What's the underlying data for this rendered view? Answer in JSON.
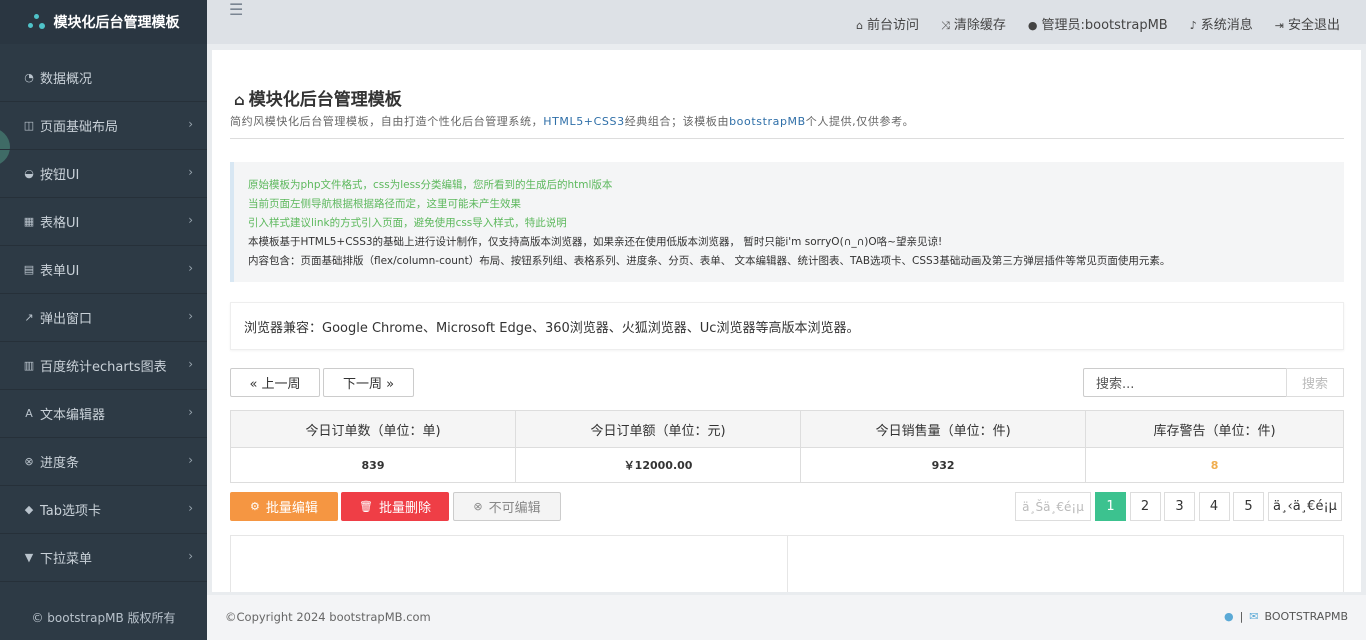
{
  "brand": {
    "title": "模块化后台管理模板"
  },
  "sidebar": {
    "items": [
      {
        "icon": "dashboard-icon",
        "glyph": "◔",
        "label": "数据概况",
        "chevron": false
      },
      {
        "icon": "columns-icon",
        "glyph": "◫",
        "label": "页面基础布局",
        "chevron": true
      },
      {
        "icon": "inbox-icon",
        "glyph": "◒",
        "label": "按钮UI",
        "chevron": true
      },
      {
        "icon": "table-icon",
        "glyph": "▦",
        "label": "表格UI",
        "chevron": true
      },
      {
        "icon": "list-alt-icon",
        "glyph": "▤",
        "label": "表单UI",
        "chevron": true
      },
      {
        "icon": "external-link-icon",
        "glyph": "↗",
        "label": "弹出窗口",
        "chevron": true
      },
      {
        "icon": "bar-chart-icon",
        "glyph": "▥",
        "label": "百度统计echarts图表",
        "chevron": true
      },
      {
        "icon": "font-icon",
        "glyph": "A",
        "label": "文本编辑器",
        "chevron": true
      },
      {
        "icon": "binoculars-icon",
        "glyph": "⊗",
        "label": "进度条",
        "chevron": true
      },
      {
        "icon": "tags-icon",
        "glyph": "◆",
        "label": "Tab选项卡",
        "chevron": true
      },
      {
        "icon": "filter-icon",
        "glyph": "▼",
        "label": "下拉菜单",
        "chevron": true
      }
    ],
    "footer": "© bootstrapMB 版权所有"
  },
  "topbar": {
    "menu_icon": "bars-icon",
    "links": [
      {
        "icon": "home-icon",
        "glyph": "⌂",
        "label": "前台访问"
      },
      {
        "icon": "random-icon",
        "glyph": "⤨",
        "label": "清除缓存"
      },
      {
        "icon": "user-icon",
        "glyph": "●",
        "label": "管理员:bootstrapMB"
      },
      {
        "icon": "bell-icon",
        "glyph": "♪",
        "label": "系统消息"
      },
      {
        "icon": "sign-out-icon",
        "glyph": "⇥",
        "label": "安全退出"
      }
    ]
  },
  "page": {
    "title_icon": "home-icon",
    "title": "模块化后台管理模板",
    "subtitle_a": "简约风模快化后台管理模板，自由打造个性化后台管理系统，",
    "subtitle_hl1": "HTML5+CSS3",
    "subtitle_b": "经典组合；该模板由",
    "subtitle_hl2": "bootstrapMB",
    "subtitle_c": "个人提供,仅供参考。"
  },
  "notes": [
    {
      "style": "g",
      "text": "原始模板为php文件格式，css为less分类编辑，您所看到的生成后的html版本"
    },
    {
      "style": "g",
      "text": "当前页面左侧导航根据根据路径而定，这里可能未产生效果"
    },
    {
      "style": "g",
      "text": "引入样式建议link的方式引入页面，避免使用css导入样式，特此说明"
    },
    {
      "style": "d",
      "text": "本模板基于HTML5+CSS3的基础上进行设计制作，仅支持高版本浏览器，如果亲还在使用低版本浏览器， 暂时只能i'm sorryO(∩_∩)O咯~望亲见谅!"
    },
    {
      "style": "d",
      "text": "内容包含：页面基础排版（flex/column-count）布局、按钮系列组、表格系列、进度条、分页、表单、 文本编辑器、统计图表、TAB选项卡、CSS3基础动画及第三方弹层插件等常见页面使用元素。"
    }
  ],
  "compat": "浏览器兼容：Google Chrome、Microsoft Edge、360浏览器、火狐浏览器、Uc浏览器等高版本浏览器。",
  "week_pager": {
    "prev": "« 上一周",
    "next": "下一周 »"
  },
  "search": {
    "placeholder": "搜索...",
    "button": "搜索"
  },
  "stats": {
    "headers": [
      "今日订单数（单位：单)",
      "今日订单额（单位：元)",
      "今日销售量（单位：件)",
      "库存警告（单位：件)"
    ],
    "values": [
      "839",
      "￥12000.00",
      "932",
      "8"
    ]
  },
  "actions": {
    "edit": "批量编辑",
    "delete": "批量删除",
    "disabled": "不可编辑"
  },
  "pagination": {
    "prev": "ä¸Šä¸€é¡µ",
    "pages": [
      "1",
      "2",
      "3",
      "4",
      "5"
    ],
    "active": "1",
    "next": "ä¸‹ä¸€é¡µ"
  },
  "footer": {
    "copyright": "©Copyright 2024 bootstrapMB.com",
    "brand": "BOOTSTRAPMB"
  },
  "colors": {
    "sidebar": "#2d3a45",
    "accent_green": "#3cc28f",
    "edit_orange": "#f59642",
    "delete_red": "#ef3e46",
    "warn": "#f0ad4e"
  }
}
